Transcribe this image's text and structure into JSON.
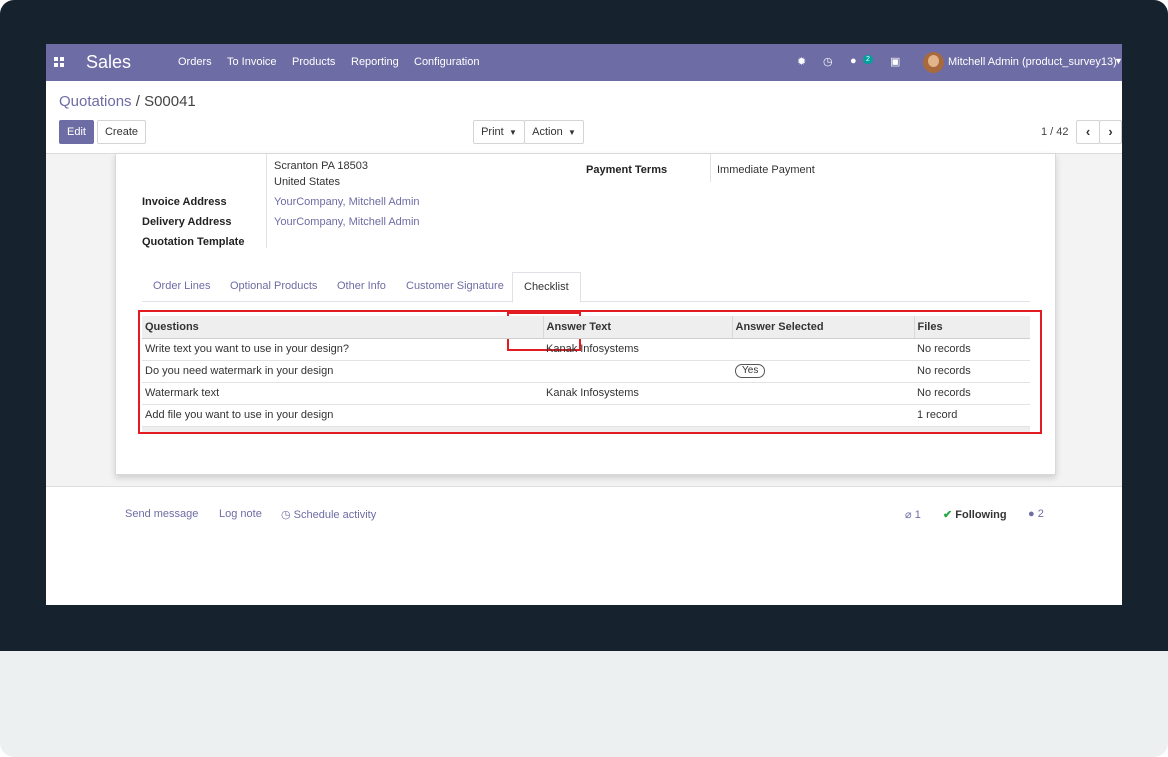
{
  "navbar": {
    "app_name": "Sales",
    "menu": [
      "Orders",
      "To Invoice",
      "Products",
      "Reporting",
      "Configuration"
    ],
    "icons": [
      "bug-icon",
      "clock-icon",
      "chat-icon",
      "gift-icon"
    ],
    "messages_badge": "2",
    "user": "Mitchell Admin (product_survey13)"
  },
  "breadcrumb": {
    "parent": "Quotations",
    "separator": "/",
    "current": "S00041"
  },
  "buttons": {
    "edit": "Edit",
    "create": "Create",
    "print": "Print",
    "action": "Action"
  },
  "pager": {
    "value": "1 / 42"
  },
  "form": {
    "address_line_1": "Scranton PA 18503",
    "address_line_2": "United States",
    "invoice_address_label": "Invoice Address",
    "invoice_address_value": "YourCompany, Mitchell Admin",
    "delivery_address_label": "Delivery Address",
    "delivery_address_value": "YourCompany, Mitchell Admin",
    "quotation_template_label": "Quotation Template",
    "payment_terms_label": "Payment Terms",
    "payment_terms_value": "Immediate Payment"
  },
  "tabs": [
    "Order Lines",
    "Optional Products",
    "Other Info",
    "Customer Signature",
    "Checklist"
  ],
  "active_tab": "Checklist",
  "checklist": {
    "headers": [
      "Questions",
      "Answer Text",
      "Answer Selected",
      "Files"
    ],
    "rows": [
      {
        "question": "Write text you want to use in your design?",
        "answer_text": "Kanak Infosystems",
        "answer_selected": "",
        "files": "No records"
      },
      {
        "question": "Do you need watermark in your design",
        "answer_text": "",
        "answer_selected": "Yes",
        "files": "No records"
      },
      {
        "question": "Watermark text",
        "answer_text": "Kanak Infosystems",
        "answer_selected": "",
        "files": "No records"
      },
      {
        "question": "Add file you want to use in your design",
        "answer_text": "",
        "answer_selected": "",
        "files": "1 record"
      }
    ]
  },
  "chatter": {
    "send_message": "Send message",
    "log_note": "Log note",
    "schedule_activity": "Schedule activity",
    "attachments_count": "1",
    "following": "Following",
    "followers_count": "2"
  },
  "colors": {
    "brand": "#6e6ca4",
    "highlight": "#e31b23",
    "bezel": "#16222e"
  }
}
